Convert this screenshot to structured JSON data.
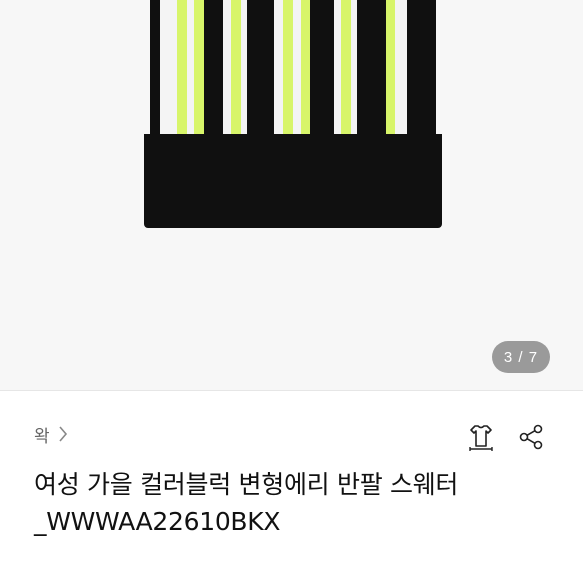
{
  "gallery": {
    "counter": "3 / 7",
    "product_colors": {
      "lime": "#d8f56a",
      "black": "#101010",
      "white": "#f4f4f4"
    }
  },
  "shop": {
    "name": "왁"
  },
  "actions": {
    "size_icon": "shirt-size-icon",
    "share_icon": "share-icon"
  },
  "product": {
    "title": "여성 가을 컬러블럭 변형에리 반팔 스웨터 _WWWAA22610BKX"
  }
}
